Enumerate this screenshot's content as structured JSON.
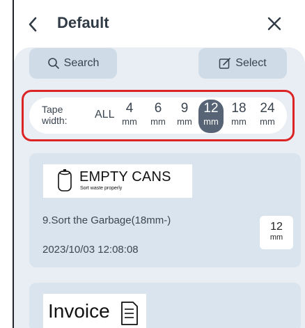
{
  "header": {
    "title": "Default",
    "back_icon": "chevron-left-icon",
    "close_icon": "close-icon"
  },
  "toolbar": {
    "search_label": "Search",
    "search_icon": "search-icon",
    "select_label": "Select",
    "select_icon": "edit-icon"
  },
  "filter": {
    "label_line1": "Tape",
    "label_line2": "width:",
    "all_label": "ALL",
    "options": [
      {
        "value": "4",
        "unit": "mm"
      },
      {
        "value": "6",
        "unit": "mm"
      },
      {
        "value": "9",
        "unit": "mm"
      },
      {
        "value": "12",
        "unit": "mm"
      },
      {
        "value": "18",
        "unit": "mm"
      },
      {
        "value": "24",
        "unit": "mm"
      }
    ],
    "selected": "12",
    "highlight_color": "#dc2424",
    "selected_color": "#566475"
  },
  "templates": [
    {
      "preview_title": "EMPTY CANS",
      "preview_subtitle": "Sort waste properly",
      "preview_icon": "can-icon",
      "name": "9.Sort the Garbage(18mm-)",
      "date": "2023/10/03 12:08:08",
      "size_value": "12",
      "size_unit": "mm"
    },
    {
      "preview_title": "Invoice",
      "preview_icon": "document-icon"
    }
  ]
}
